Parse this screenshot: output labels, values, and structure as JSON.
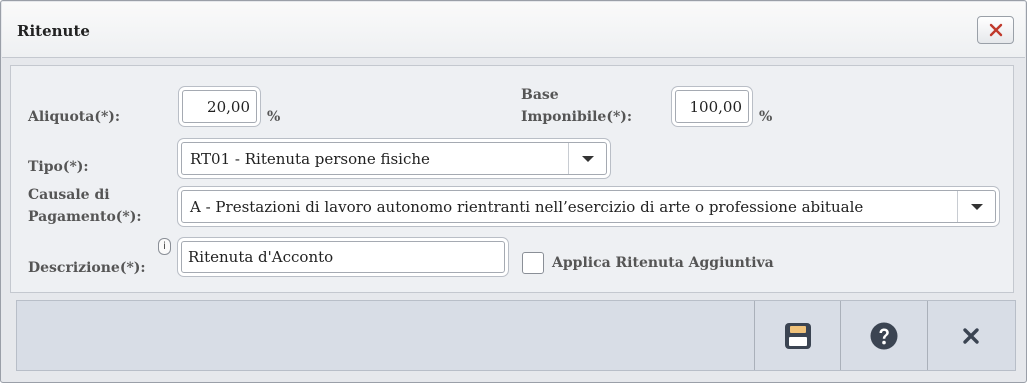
{
  "dialog": {
    "title": "Ritenute"
  },
  "form": {
    "aliquota": {
      "label": "Aliquota(*):",
      "value": "20,00",
      "unit": "%"
    },
    "base_imponibile": {
      "label_line1": "Base",
      "label_line2": "Imponibile(*):",
      "value": "100,00",
      "unit": "%"
    },
    "tipo": {
      "label": "Tipo(*):",
      "value": "RT01 - Ritenuta persone fisiche"
    },
    "causale": {
      "label_line1": "Causale di",
      "label_line2": "Pagamento(*):",
      "value": "A - Prestazioni di lavoro autonomo rientranti nell’esercizio di arte o professione abituale"
    },
    "descrizione": {
      "label": "Descrizione(*):",
      "value": "Ritenuta d'Acconto",
      "info": "i"
    },
    "applica_ritenuta": {
      "label": "Applica Ritenuta Aggiuntiva",
      "checked": false
    }
  },
  "icons": {
    "title_close": "close-icon",
    "save": "save-icon",
    "help": "help-icon",
    "close": "close-icon"
  },
  "colors": {
    "close_red": "#c0392b",
    "icon_dark": "#3b4452",
    "save_accent": "#f0c27a"
  }
}
